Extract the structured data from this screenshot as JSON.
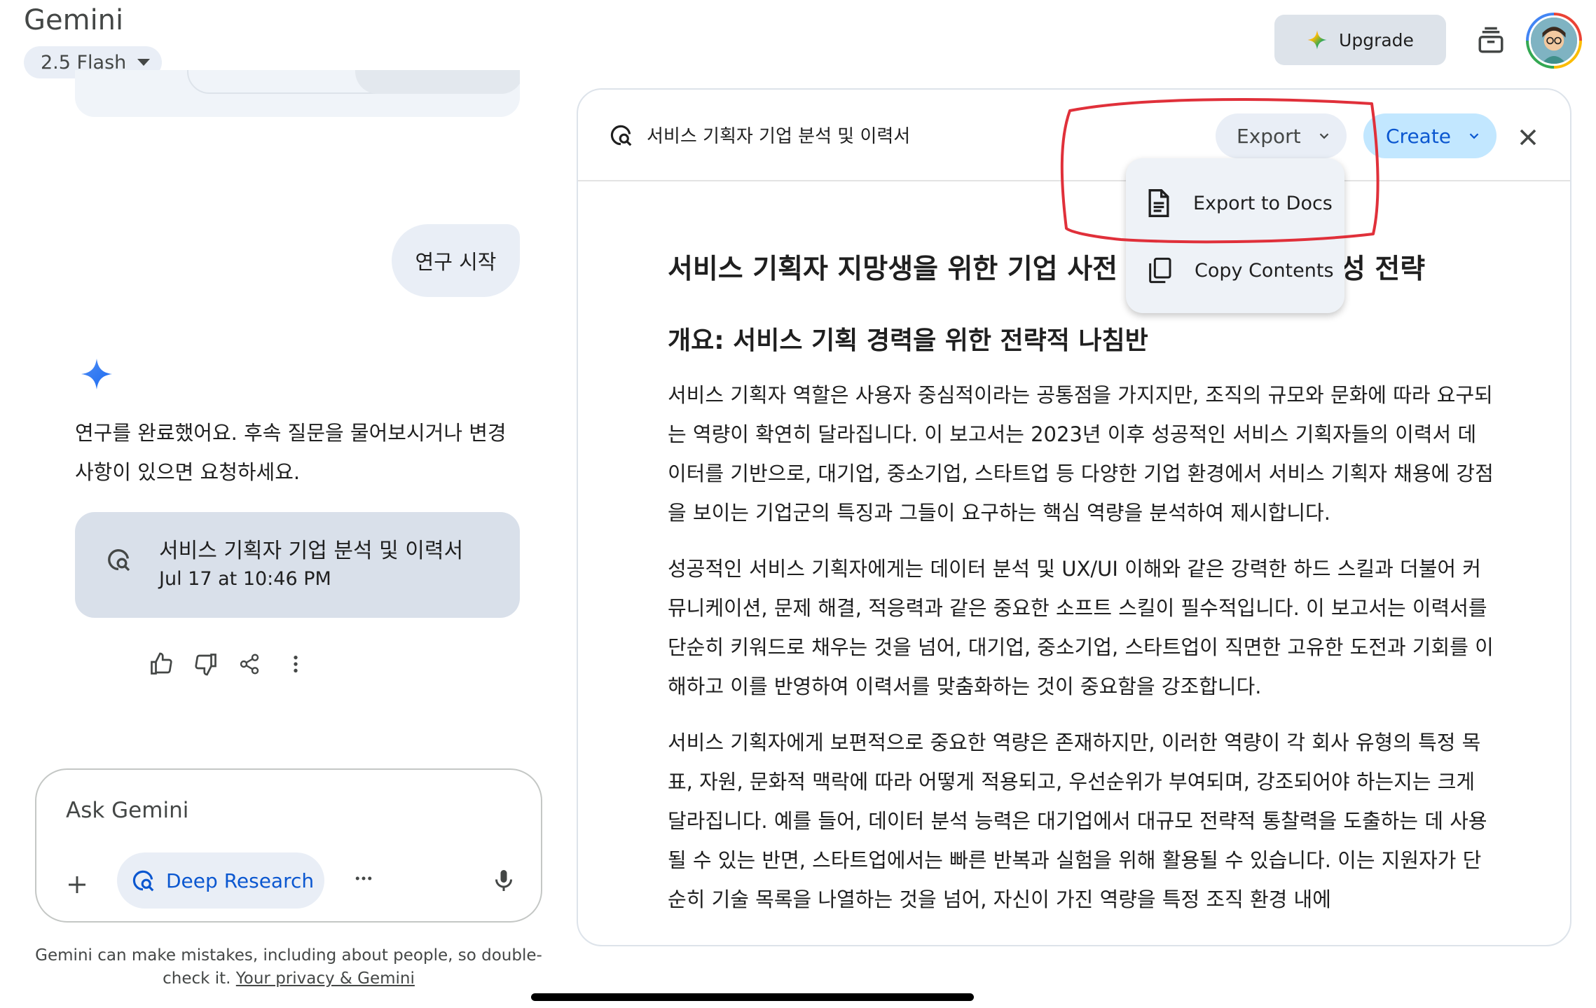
{
  "header": {
    "app_title": "Gemini",
    "model_label": "2.5 Flash",
    "upgrade_label": "Upgrade"
  },
  "chat": {
    "user_message": "연구 시작",
    "reply_line1": "연구를 완료했어요. 후속 질문을 물어보시거나 변경",
    "reply_line2": "사항이 있으면 요청하세요.",
    "research_card": {
      "title": "서비스 기획자 기업 분석 및 이력서",
      "date": "Jul 17 at 10:46 PM"
    }
  },
  "composer": {
    "placeholder": "Ask Gemini",
    "deep_research_label": "Deep Research"
  },
  "disclaimer": {
    "text": "Gemini can make mistakes, including about people, so double-check it.",
    "link": "Your privacy & Gemini"
  },
  "panel": {
    "title": "서비스 기획자 기업 분석 및 이력서",
    "export_label": "Export",
    "create_label": "Create",
    "menu": {
      "export_docs": "Export to Docs",
      "copy_contents": "Copy Contents"
    },
    "doc": {
      "heading_visible_left": "서비스 기획자 지망생을 위한 기업 사전",
      "heading_visible_right": "성 전략",
      "subheading": "개요: 서비스 기획 경력을 위한 전략적 나침반",
      "paragraphs": [
        "서비스 기획자 역할은 사용자 중심적이라는 공통점을 가지지만, 조직의 규모와 문화에 따라 요구되는 역량이 확연히 달라집니다. 이 보고서는 2023년 이후 성공적인 서비스 기획자들의 이력서 데이터를 기반으로, 대기업, 중소기업, 스타트업 등 다양한 기업 환경에서 서비스 기획자 채용에 강점을 보이는 기업군의 특징과 그들이 요구하는 핵심 역량을 분석하여 제시합니다.",
        "성공적인 서비스 기획자에게는 데이터 분석 및 UX/UI 이해와 같은 강력한 하드 스킬과 더불어 커뮤니케이션, 문제 해결, 적응력과 같은 중요한 소프트 스킬이 필수적입니다. 이 보고서는 이력서를 단순히 키워드로 채우는 것을 넘어, 대기업, 중소기업, 스타트업이 직면한 고유한 도전과 기회를 이해하고 이를 반영하여 이력서를 맞춤화하는 것이 중요함을 강조합니다.",
        "서비스 기획자에게 보편적으로 중요한 역량은 존재하지만, 이러한 역량이 각 회사 유형의 특정 목표, 자원, 문화적 맥락에 따라 어떻게 적용되고, 우선순위가 부여되며, 강조되어야 하는지는 크게 달라집니다. 예를 들어, 데이터 분석 능력은 대기업에서 대규모 전략적 통찰력을 도출하는 데 사용될 수 있는 반면, 스타트업에서는 빠른 반복과 실험을 위해 활용될 수 있습니다. 이는 지원자가 단순히 기술 목록을 나열하는 것을 넘어, 자신이 가진 역량을 특정 조직 환경 내에"
      ]
    }
  },
  "colors": {
    "accent_blue": "#0b57d0",
    "create_bg": "#c2e7ff",
    "annotation_red": "#e0303a"
  },
  "icons": [
    "spark-icon",
    "history-icon",
    "deep-research-icon",
    "thumbs-up-icon",
    "thumbs-down-icon",
    "share-icon",
    "more-vert-icon",
    "plus-icon",
    "mic-icon",
    "chevron-down-icon",
    "close-icon",
    "docs-icon",
    "copy-icon"
  ]
}
